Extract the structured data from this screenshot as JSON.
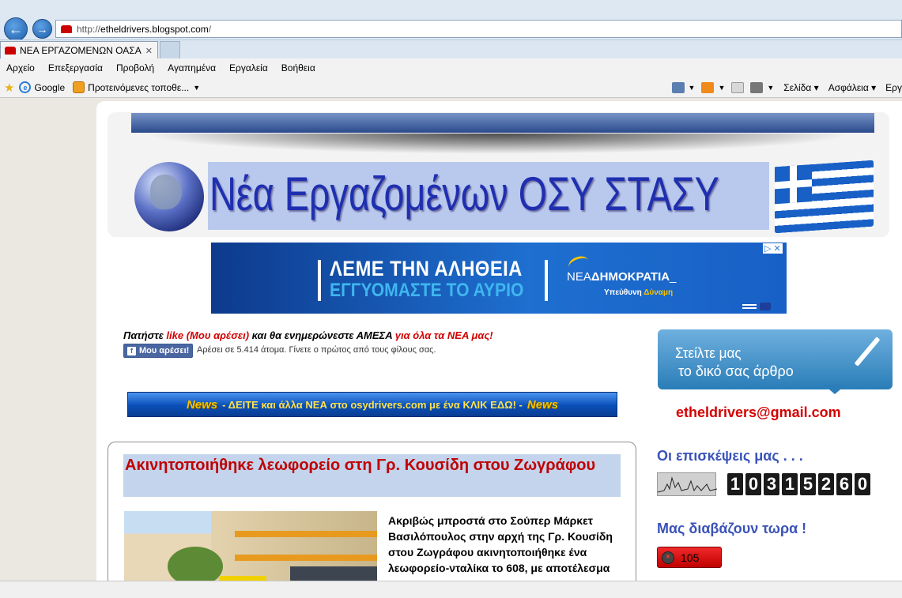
{
  "browser": {
    "back_glyph": "←",
    "forward_glyph": "→",
    "url_prefix": "http://",
    "url_host": "etheldrivers.blogspot.com",
    "url_suffix": "/",
    "tab_title": "ΝΕΑ ΕΡΓΑΖΟΜΕΝΩΝ ΟΑΣΑ",
    "tab_close": "✕",
    "menu": [
      "Αρχείο",
      "Επεξεργασία",
      "Προβολή",
      "Αγαπημένα",
      "Εργαλεία",
      "Βοήθεια"
    ],
    "favorites": {
      "google_label": "Google",
      "suggested_label": "Προτεινόμενες τοποθε...",
      "caret": "▼"
    },
    "commands": {
      "page_label": "Σελίδα ▾",
      "safety_label": "Ασφάλεια ▾",
      "tools_label": "Εργ"
    },
    "icons": {
      "favorites": "star-icon",
      "ie": "ie-icon",
      "home": "home-icon",
      "feeds": "rss-icon",
      "mail": "mail-icon",
      "print": "print-icon"
    }
  },
  "header": {
    "site_title": "Νέα Εργαζομένων ΟΣΥ ΣΤΑΣΥ"
  },
  "ad": {
    "line1": "ΛΕΜΕ ΤΗΝ ΑΛΗΘΕΙΑ",
    "line2": "ΕΓΓΥΟΜΑΣΤΕ ΤΟ ΑΥΡΙΟ",
    "logo_prefix": "ΝΕΑ",
    "logo_main": "ΔΗΜΟΚΡΑΤΙΑ",
    "slogan_a": "Υπεύθυνη",
    "slogan_b": "Δύναμη",
    "choices": "▷ ✕"
  },
  "like": {
    "prompt_a": "Πατήστε ",
    "prompt_b": "like (Μου αρέσει)",
    "prompt_c": " και θα ενημερώνεστε ΑΜΕΣΑ ",
    "prompt_d": "για όλα τα ΝΕΑ μας!",
    "button_icon": "f",
    "button_label": "Μου αρέσει!",
    "count_text": "Αρέσει σε 5.414 άτομα. Γίνετε ο πρώτος από τους φίλους σας."
  },
  "news_banner": {
    "word": "News",
    "text": "- ΔΕΙΤΕ και άλλα ΝΕΑ στο osydrivers.com με ένα ΚΛΙΚ ΕΔΩ! -"
  },
  "post": {
    "title": "Ακινητοποιήθηκε λεωφορείο στη Γρ. Κουσίδη στου Ζωγράφου",
    "text": "Ακριβώς μπροστά στο Σούπερ Μάρκετ Βασιλόπουλος στην αρχή της Γρ. Κουσίδη στου Ζωγράφου ακινητοποιήθηκε ένα λεωφορείο-νταλίκα το 608, με αποτέλεσμα να"
  },
  "sidebar": {
    "send_line1": "Στείλτε μας",
    "send_line2": "το δικό σας άρθρο",
    "email": "etheldrivers@gmail.com",
    "visits_title": "Οι επισκέψεις μας . . .",
    "counter_digits": [
      "1",
      "0",
      "3",
      "1",
      "5",
      "2",
      "6",
      "0"
    ],
    "readers_title": "Μας διαβάζουν τωρα !",
    "readers_count": "105"
  },
  "colors": {
    "title_blue": "#1f2fb0",
    "accent_red": "#d40000",
    "sidebar_blue": "#3a53b8"
  }
}
